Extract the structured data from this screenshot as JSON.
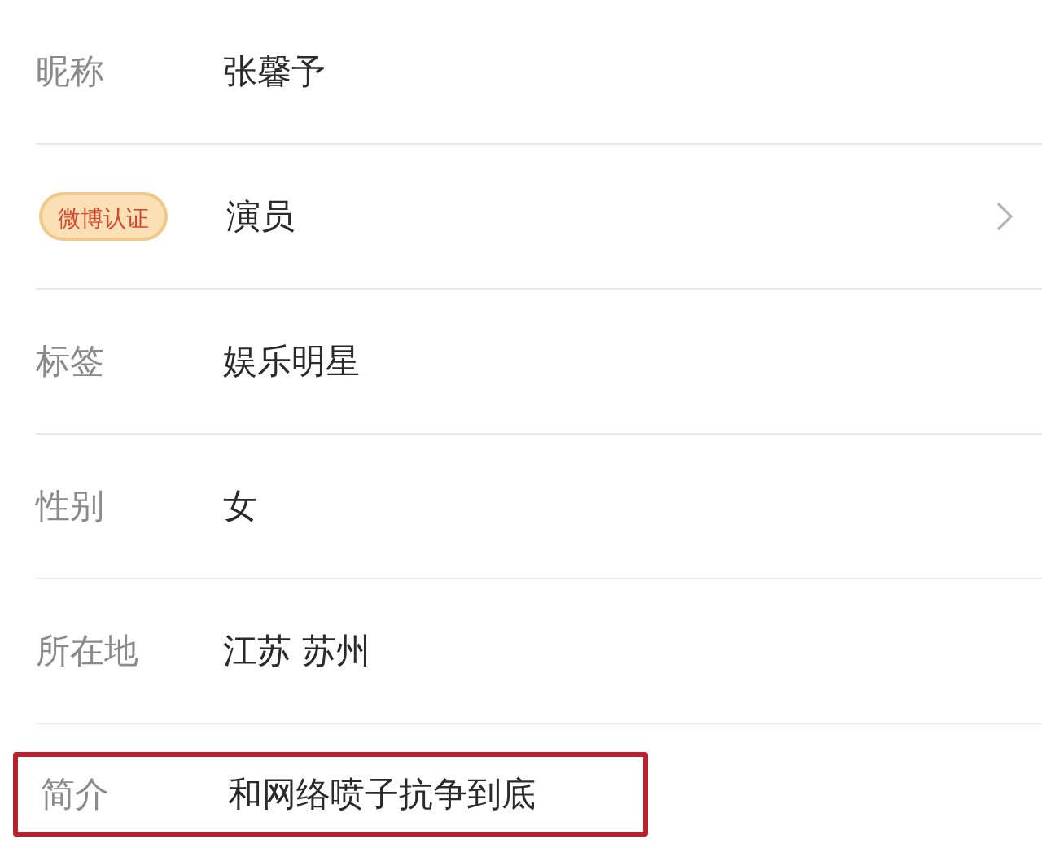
{
  "rows": [
    {
      "kind": "text",
      "label": "昵称",
      "value": "张馨予",
      "chevron": false,
      "highlighted": false
    },
    {
      "kind": "badge",
      "label": "微博认证",
      "value": "演员",
      "chevron": true,
      "highlighted": false
    },
    {
      "kind": "text",
      "label": "标签",
      "value": "娱乐明星",
      "chevron": false,
      "highlighted": false
    },
    {
      "kind": "text",
      "label": "性别",
      "value": "女",
      "chevron": false,
      "highlighted": false
    },
    {
      "kind": "text",
      "label": "所在地",
      "value": "江苏 苏州",
      "chevron": false,
      "highlighted": false
    },
    {
      "kind": "text",
      "label": "简介",
      "value": "和网络喷子抗争到底",
      "chevron": false,
      "highlighted": true
    }
  ]
}
